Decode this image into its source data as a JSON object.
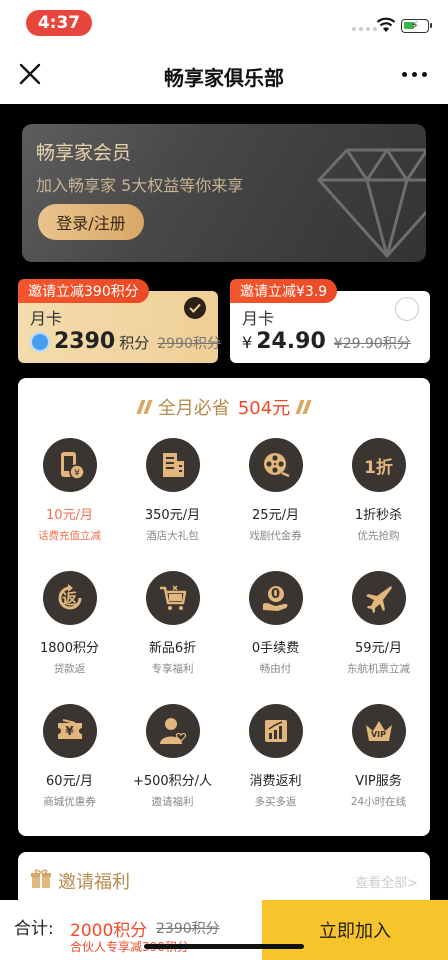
{
  "status": {
    "time": "4:37"
  },
  "nav": {
    "title": "畅享家俱乐部"
  },
  "banner": {
    "title": "畅享家会员",
    "subtitle": "加入畅享家 5大权益等你来享",
    "login_label": "登录/注册"
  },
  "plans": [
    {
      "tag": "邀请立减390积分",
      "name": "月卡",
      "price": "2390",
      "unit": "积分",
      "old": "2990积分",
      "selected": true
    },
    {
      "tag": "邀请立减¥3.9",
      "name": "月卡",
      "currency": "¥",
      "price": "24.90",
      "old": "¥29.90积分",
      "selected": false
    }
  ],
  "benefits": {
    "title": "全月必省",
    "amount": "504元",
    "items": [
      {
        "title": "10元/月",
        "sub": "话费充值立减",
        "icon": "phone-icon",
        "highlight": true
      },
      {
        "title": "350元/月",
        "sub": "酒店大礼包",
        "icon": "hotel-icon"
      },
      {
        "title": "25元/月",
        "sub": "戏剧代金券",
        "icon": "film-reel-icon"
      },
      {
        "title": "1折秒杀",
        "sub": "优先抢购",
        "icon": "discount-icon",
        "icon_text": "1折"
      },
      {
        "title": "1800积分",
        "sub": "贷款返",
        "icon": "return-icon",
        "icon_text": "返"
      },
      {
        "title": "新品6折",
        "sub": "专享福利",
        "icon": "cart-icon"
      },
      {
        "title": "0手续费",
        "sub": "畅由付",
        "icon": "hand-coin-icon",
        "icon_text": "0"
      },
      {
        "title": "59元/月",
        "sub": "东航机票立减",
        "icon": "plane-icon"
      },
      {
        "title": "60元/月",
        "sub": "商城优惠券",
        "icon": "coupon-icon",
        "icon_text": "¥"
      },
      {
        "title": "+500积分/人",
        "sub": "邀请福利",
        "icon": "user-heart-icon"
      },
      {
        "title": "消费返利",
        "sub": "多买多返",
        "icon": "chart-icon"
      },
      {
        "title": "VIP服务",
        "sub": "24小时在线",
        "icon": "crown-icon",
        "icon_text": "VIP"
      }
    ]
  },
  "invite": {
    "title": "邀请福利",
    "all_label": "查看全部>"
  },
  "footer": {
    "total_label": "合计:",
    "price": "2000积分",
    "old": "2390积分",
    "note": "合伙人专享减390积分",
    "join_label": "立即加入"
  },
  "colors": {
    "accent": "#f04a2a",
    "gold": "#d8a766",
    "join": "#f7c42c"
  }
}
